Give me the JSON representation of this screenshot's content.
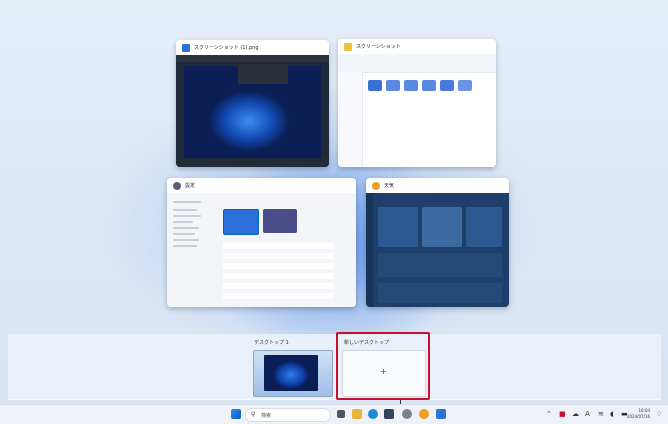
{
  "windows": {
    "screenshot": {
      "title": "スクリーンショット (1).png"
    },
    "explorer": {
      "title": "スクリーンショット"
    },
    "settings": {
      "title": "設定"
    },
    "weather": {
      "title": "天気"
    }
  },
  "desktops": {
    "desktop1": {
      "label": "デスクトップ 1"
    },
    "new_desktop": {
      "label": "新しいデスクトップ",
      "plus": "+"
    }
  },
  "taskbar": {
    "search_label": "検索",
    "clock_time": "16:04",
    "clock_date": "2024/07/16"
  },
  "colors": {
    "highlight": "#c8102e",
    "accent": "#0067c0"
  }
}
